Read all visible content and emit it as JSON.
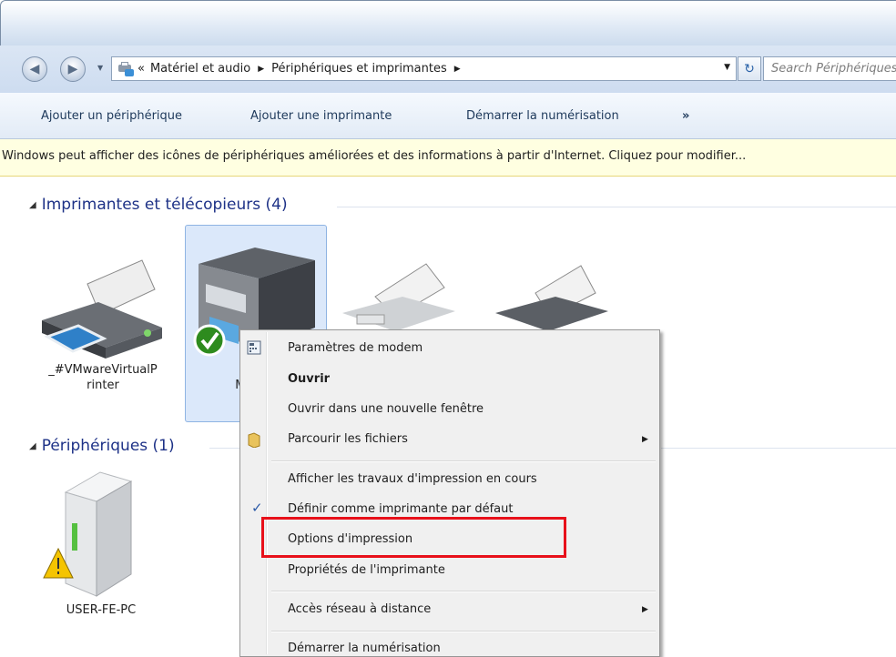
{
  "address": {
    "crumbs": [
      "«",
      "Matériel et audio",
      "Périphériques et imprimantes"
    ],
    "search_placeholder": "Search Périphériques et imprimantes"
  },
  "commands": [
    "Ajouter un périphérique",
    "Ajouter une imprimante",
    "Démarrer la numérisation",
    "»"
  ],
  "infobar": "Windows peut afficher des icônes de périphériques améliorées et des informations à partir d'Internet. Cliquez pour modifier...",
  "groups": {
    "printers": "Imprimantes et télécopieurs (4)",
    "devices": "Périphériques (1)"
  },
  "devices": {
    "vmware": "_#VMwareVirtualP\nrinter",
    "brother_partial": "B\nMFC\nP",
    "pc": "USER-FE-PC"
  },
  "context_menu": {
    "items": [
      "Paramètres de modem",
      "Ouvrir",
      "Ouvrir dans une nouvelle fenêtre",
      "Parcourir les fichiers",
      "Afficher les travaux d'impression en cours",
      "Définir comme imprimante par défaut",
      "Options d'impression",
      "Propriétés de l'imprimante",
      "Accès réseau à distance",
      "Démarrer la numérisation"
    ]
  },
  "colors": {
    "highlight": "#e8101a",
    "selection": "#dbe8fa",
    "group_heading": "#1e3287"
  }
}
